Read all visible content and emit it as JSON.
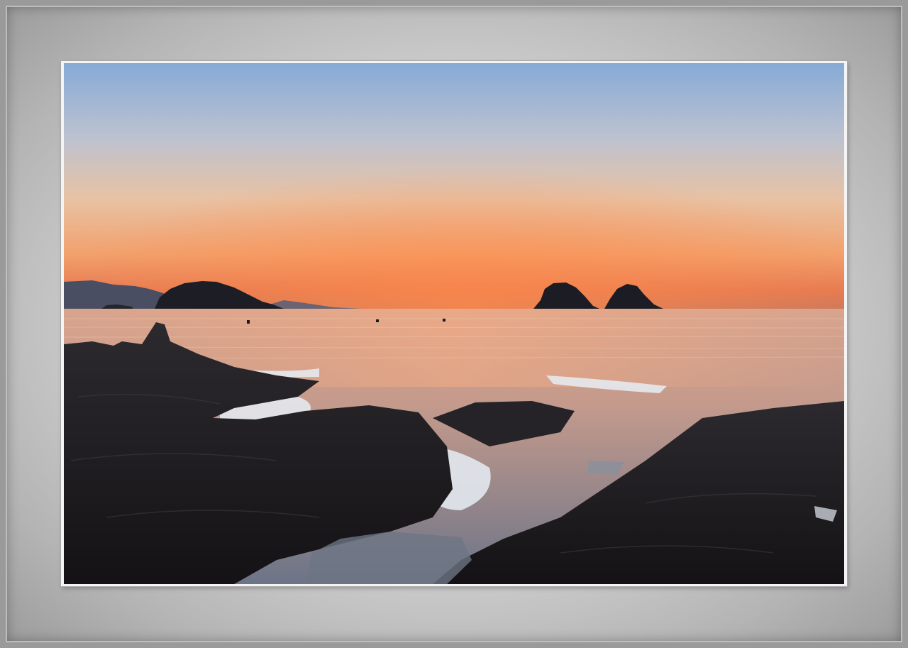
{
  "scene": {
    "subject": "sunset-over-sea-with-rocky-shore",
    "colors": {
      "sky_top": "#8fb3d9",
      "sky_mid": "#d9c5b8",
      "sky_glow": "#f2a36a",
      "horizon": "#e07a4e",
      "sea": "#c99a86",
      "rock": "#1f1d1f",
      "surf": "#e8eef5",
      "frame": "#9a9a9a",
      "mat": "#d8d8d8"
    }
  }
}
